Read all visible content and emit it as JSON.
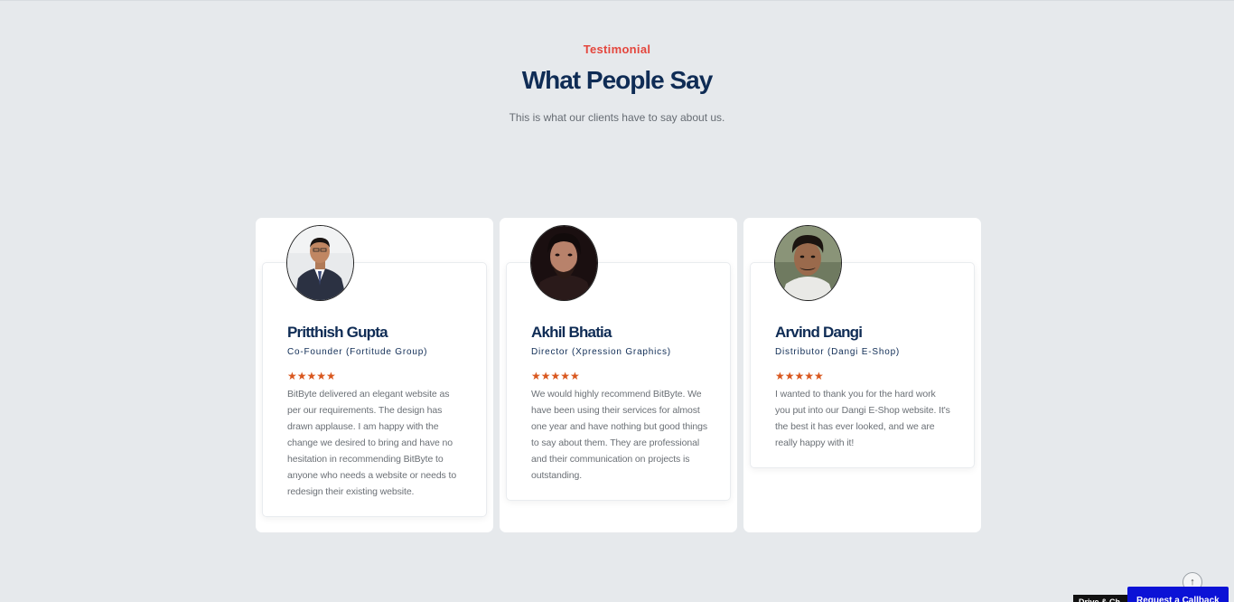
{
  "section": {
    "eyebrow": "Testimonial",
    "title": "What People Say",
    "subtitle": "This is what our clients have to say about us."
  },
  "testimonials": [
    {
      "name": "Pritthish Gupta",
      "role": "Co-Founder (Fortitude Group)",
      "stars": "★★★★★",
      "rating": 5,
      "quote": "BitByte delivered an elegant website as per our requirements. The design has drawn applause. I am happy with the change we desired to bring and have no hesitation in recommending BitByte to anyone who needs a website or needs to redesign their existing website."
    },
    {
      "name": "Akhil Bhatia",
      "role": "Director (Xpression Graphics)",
      "stars": "★★★★★",
      "rating": 5,
      "quote": "We would highly recommend BitByte. We have been using their services for almost one year and have nothing but good things to say about them. They are professional and their communication on projects is outstanding."
    },
    {
      "name": "Arvind Dangi",
      "role": "Distributor (Dangi E-Shop)",
      "stars": "★★★★★",
      "rating": 5,
      "quote": "I wanted to thank you for the hard work you put into our Dangi E-Shop website. It's the best it has ever looked, and we are really happy with it!"
    }
  ],
  "widgets": {
    "scroll_top_icon": "arrow-up-icon",
    "scroll_top_glyph": "↑",
    "chat_label": "Drive & Ch",
    "callback_label": "Request a Callback"
  },
  "colors": {
    "accent": "#e4463d",
    "heading": "#0f2c55",
    "stars": "#d9571e",
    "callback": "#0b12d6"
  }
}
